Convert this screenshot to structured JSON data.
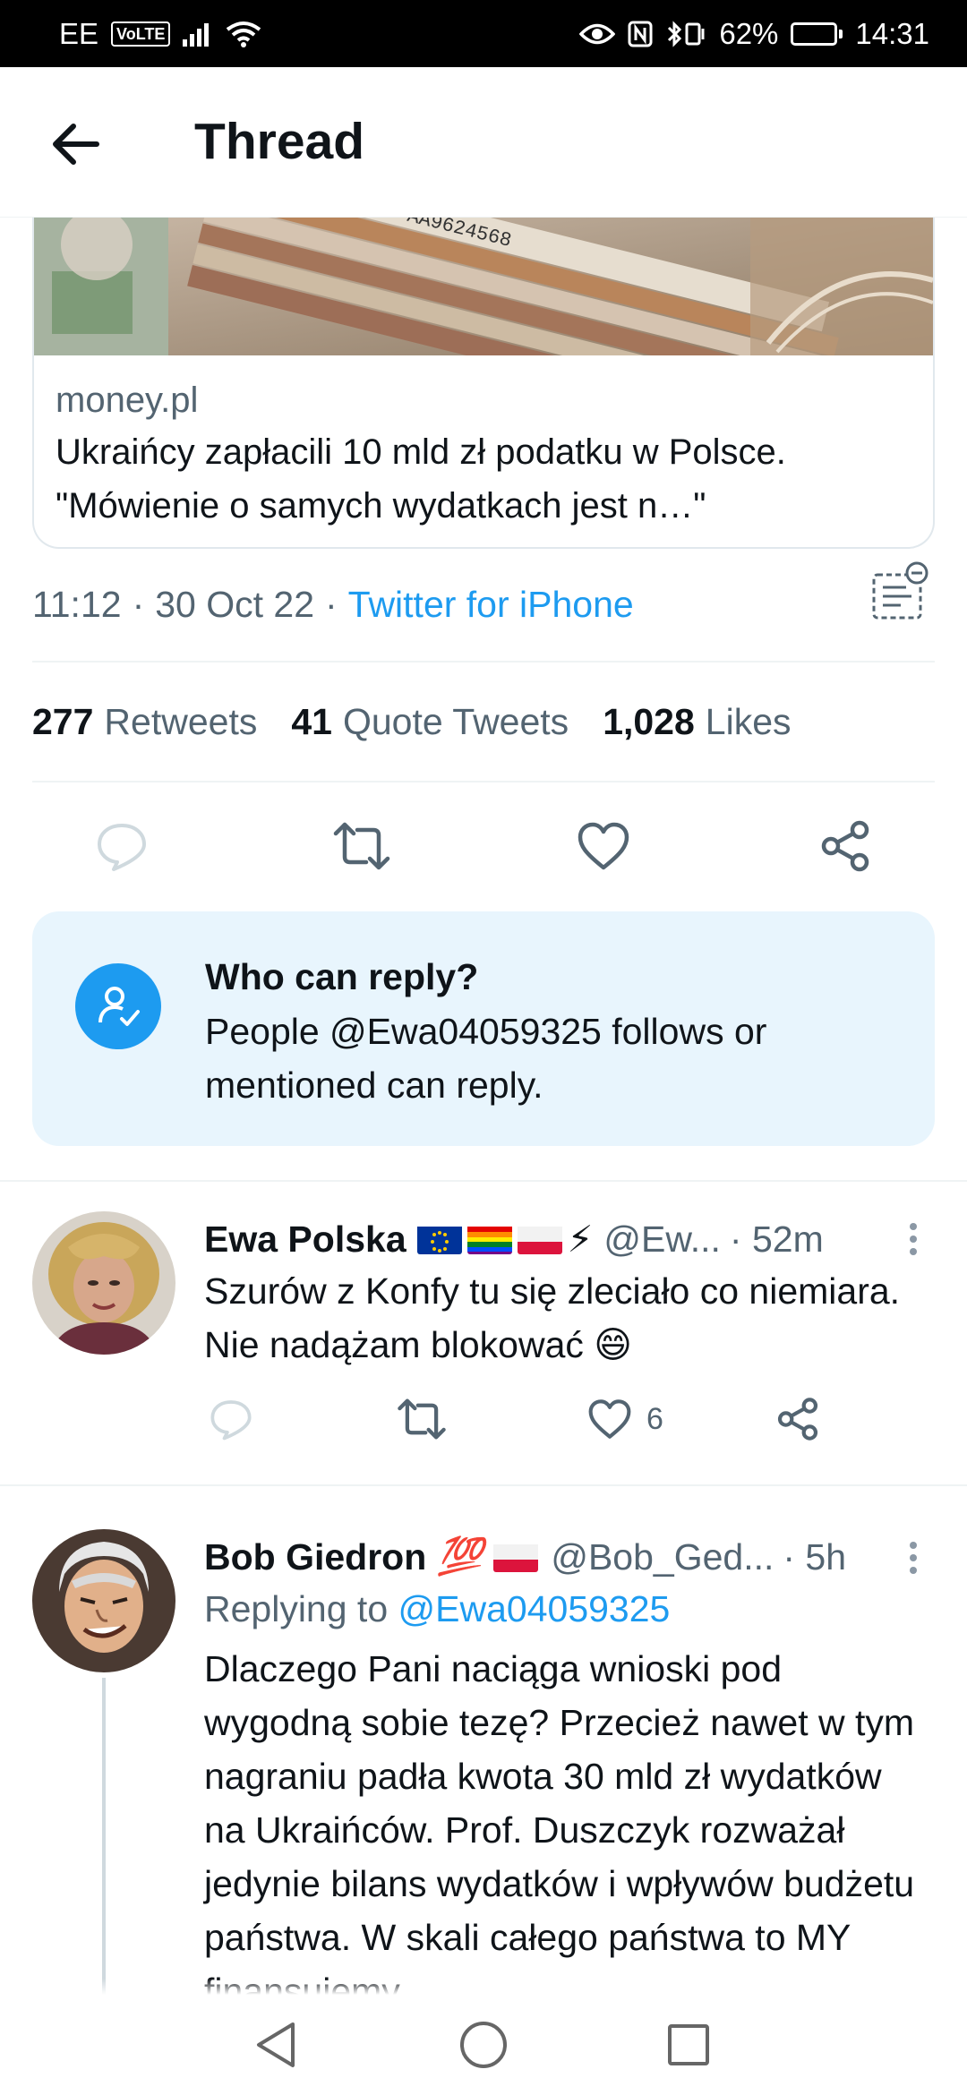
{
  "status_bar": {
    "carrier": "EE",
    "volte": "VoLTE",
    "battery": "62%",
    "battery_level": 0.62,
    "time": "14:31"
  },
  "header": {
    "title": "Thread"
  },
  "link_card": {
    "domain": "money.pl",
    "title": "Ukraińcy zapłacili 10 mld zł podatku w Polsce. \"Mówienie o samych wydatkach jest n…\"",
    "image_serial": "AA9624568"
  },
  "meta": {
    "time": "11:12",
    "date": "30 Oct 22",
    "separator": "·",
    "source": "Twitter for iPhone"
  },
  "stats": {
    "retweets_count": "277",
    "retweets_label": "Retweets",
    "quotes_count": "41",
    "quotes_label": "Quote Tweets",
    "likes_count": "1,028",
    "likes_label": "Likes"
  },
  "who_can_reply": {
    "heading": "Who can reply?",
    "body": "People @Ewa04059325 follows or mentioned can reply."
  },
  "tweets": [
    {
      "name": "Ewa Polska",
      "emoji": "⚡",
      "handle": "@Ew...",
      "time": "· 52m",
      "text": "Szurów z Konfy tu się zleciało co niemiara. Nie nadążam blokować 😄",
      "likes": "6"
    },
    {
      "name": "Bob Giedron",
      "emoji": "💯",
      "handle": "@Bob_Ged...",
      "time": "· 5h",
      "replying_label": "Replying to",
      "replying_to": "@Ewa04059325",
      "text": "Dlaczego Pani naciąga wnioski pod wygodną sobie tezę? Przecież nawet w tym nagraniu padła kwota 30 mld zł wydatków na Ukraińców. Prof. Duszczyk rozważał jedynie bilans wydatków i wpływów budżetu państwa. W skali całego państwa to MY finansujemy"
    }
  ],
  "colors": {
    "accent": "#1d9bf0",
    "secondary_text": "#536471",
    "reply_box_bg": "#e8f5fd"
  }
}
